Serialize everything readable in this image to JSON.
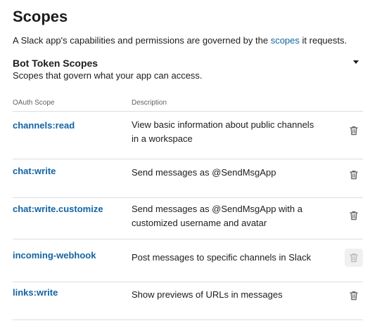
{
  "header": {
    "title": "Scopes",
    "intro_before": "A Slack app's capabilities and permissions are governed by the ",
    "intro_link": "scopes",
    "intro_after": " it requests."
  },
  "section": {
    "title": "Bot Token Scopes",
    "subtitle": "Scopes that govern what your app can access.",
    "toggle_icon": "caret-down-icon"
  },
  "table": {
    "columns": [
      "OAuth Scope",
      "Description"
    ],
    "rows": [
      {
        "scope": "channels:read",
        "description": "View basic information about public channels in a workspace",
        "remove_icon": "trash-icon",
        "removable": true
      },
      {
        "scope": "chat:write",
        "description": "Send messages as @SendMsgApp",
        "remove_icon": "trash-icon",
        "removable": true
      },
      {
        "scope": "chat:write.customize",
        "description": "Send messages as @SendMsgApp with a customized username and avatar",
        "remove_icon": "trash-icon",
        "removable": true
      },
      {
        "scope": "incoming-webhook",
        "description": "Post messages to specific channels in Slack",
        "remove_icon": "trash-icon",
        "removable": false
      },
      {
        "scope": "links:write",
        "description": "Show previews of URLs in messages",
        "remove_icon": "trash-icon",
        "removable": true
      }
    ]
  },
  "colors": {
    "link": "#1264a3",
    "text": "#1d1c1d",
    "muted": "#616061",
    "rule": "#dddddd",
    "icon": "#616061",
    "disabled_bg": "#f0f0f0"
  }
}
